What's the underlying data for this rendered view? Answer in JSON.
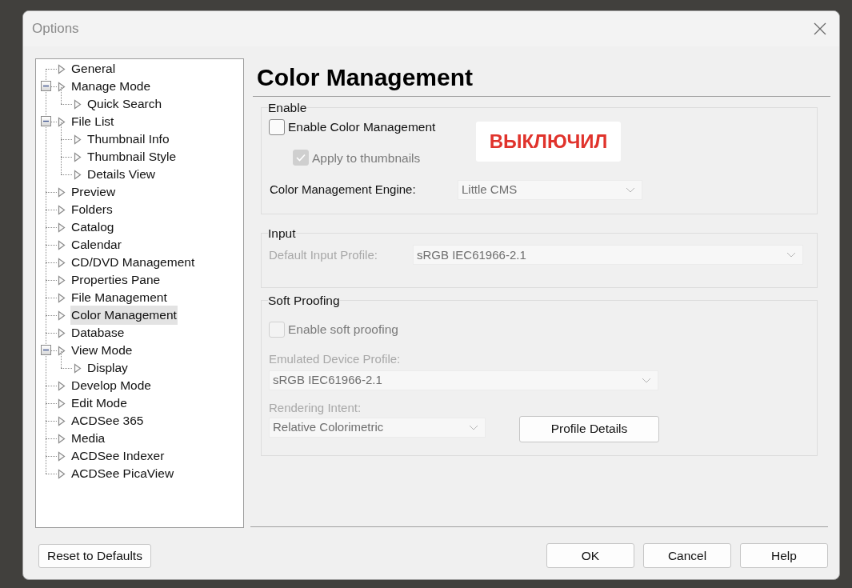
{
  "window": {
    "title": "Options"
  },
  "tree": [
    {
      "label": "General",
      "selected": false
    },
    {
      "label": "Manage Mode",
      "selected": false,
      "expanded": true,
      "children": [
        {
          "label": "Quick Search",
          "selected": false
        }
      ]
    },
    {
      "label": "File List",
      "selected": false,
      "expanded": true,
      "children": [
        {
          "label": "Thumbnail Info",
          "selected": false
        },
        {
          "label": "Thumbnail Style",
          "selected": false
        },
        {
          "label": "Details View",
          "selected": false
        }
      ]
    },
    {
      "label": "Preview",
      "selected": false
    },
    {
      "label": "Folders",
      "selected": false
    },
    {
      "label": "Catalog",
      "selected": false
    },
    {
      "label": "Calendar",
      "selected": false
    },
    {
      "label": "CD/DVD Management",
      "selected": false
    },
    {
      "label": "Properties Pane",
      "selected": false
    },
    {
      "label": "File Management",
      "selected": false
    },
    {
      "label": "Color Management",
      "selected": true
    },
    {
      "label": "Database",
      "selected": false
    },
    {
      "label": "View Mode",
      "selected": false,
      "expanded": true,
      "children": [
        {
          "label": "Display",
          "selected": false
        }
      ]
    },
    {
      "label": "Develop Mode",
      "selected": false
    },
    {
      "label": "Edit Mode",
      "selected": false
    },
    {
      "label": "ACDSee 365",
      "selected": false
    },
    {
      "label": "Media",
      "selected": false
    },
    {
      "label": "ACDSee Indexer",
      "selected": false
    },
    {
      "label": "ACDSee PicaView",
      "selected": false
    }
  ],
  "page_title": "Color Management",
  "enable_group": {
    "title": "Enable",
    "enable_checkbox": {
      "label": "Enable Color Management",
      "checked": false,
      "disabled": false
    },
    "thumbnails_checkbox": {
      "label": "Apply to thumbnails",
      "checked": true,
      "disabled": true
    },
    "annotation": "ВЫКЛЮЧИЛ",
    "engine": {
      "label": "Color Management Engine:",
      "value": "Little CMS",
      "disabled": true,
      "label_disabled": false
    }
  },
  "input_group": {
    "title": "Input",
    "profile": {
      "label": "Default Input Profile:",
      "value": "sRGB IEC61966-2.1",
      "disabled": true,
      "label_disabled": true
    }
  },
  "soft_proofing_group": {
    "title": "Soft Proofing",
    "checkbox": {
      "label": "Enable soft proofing",
      "checked": false,
      "disabled": true
    },
    "device_profile": {
      "label": "Emulated Device Profile:",
      "value": "sRGB IEC61966-2.1",
      "disabled": true,
      "label_disabled": true
    },
    "intent": {
      "label": "Rendering Intent:",
      "value": "Relative Colorimetric",
      "disabled": true,
      "label_disabled": true
    },
    "details_button": "Profile Details"
  },
  "reset_button": "Reset to Defaults",
  "buttons": [
    "OK",
    "Cancel",
    "Help"
  ]
}
